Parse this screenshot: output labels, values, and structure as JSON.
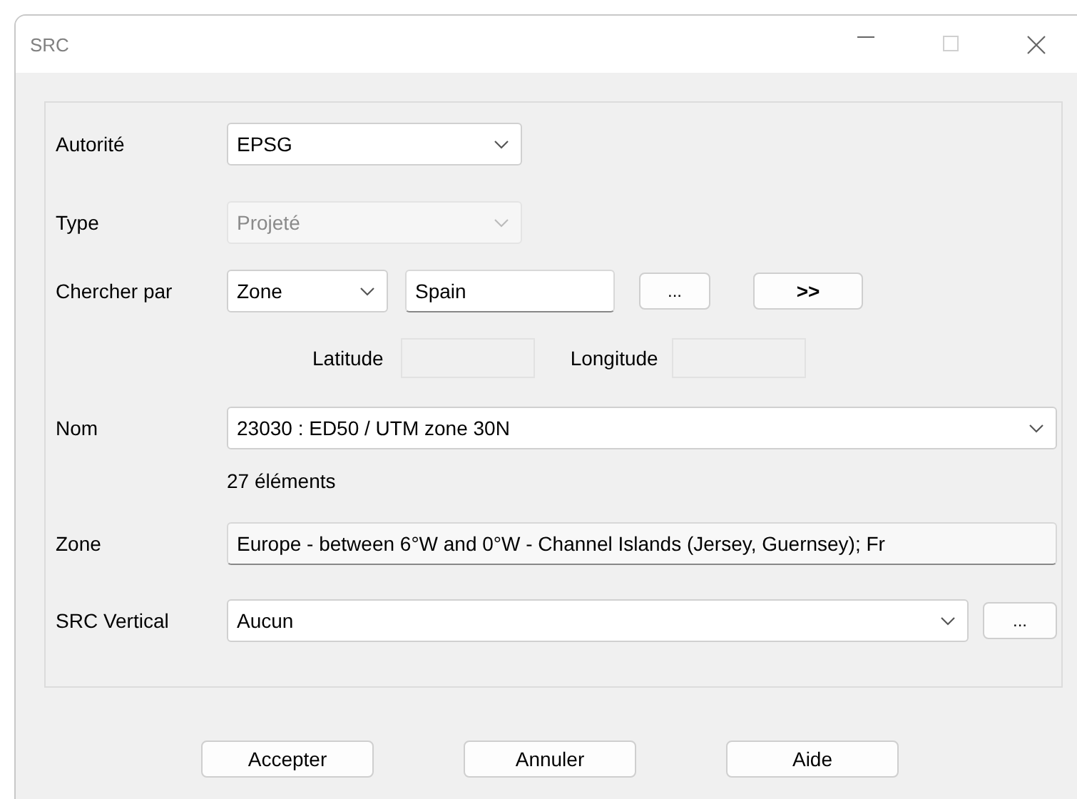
{
  "window": {
    "title": "SRC"
  },
  "authority": {
    "label": "Autorité",
    "value": "EPSG",
    "disabled": false
  },
  "type": {
    "label": "Type",
    "value": "Projeté",
    "disabled": true
  },
  "search": {
    "label": "Chercher par",
    "by": "Zone",
    "query": "Spain",
    "buttons": [
      "...",
      ">>"
    ]
  },
  "coordinates": [
    {
      "label": "Latitude",
      "disabled": true
    },
    {
      "label": "Longitude",
      "disabled": true
    }
  ],
  "name": {
    "label": "Nom",
    "value": "23030 : ED50 / UTM zone 30N",
    "count": "27 éléments"
  },
  "zone": {
    "label": "Zone",
    "value": "Europe - between 6°W and 0°W - Channel Islands (Jersey, Guernsey); Fr"
  },
  "vertical": {
    "label": "SRC Vertical",
    "value": "Aucun",
    "button": "..."
  },
  "buttons": [
    "Accepter",
    "Annuler",
    "Aide"
  ]
}
